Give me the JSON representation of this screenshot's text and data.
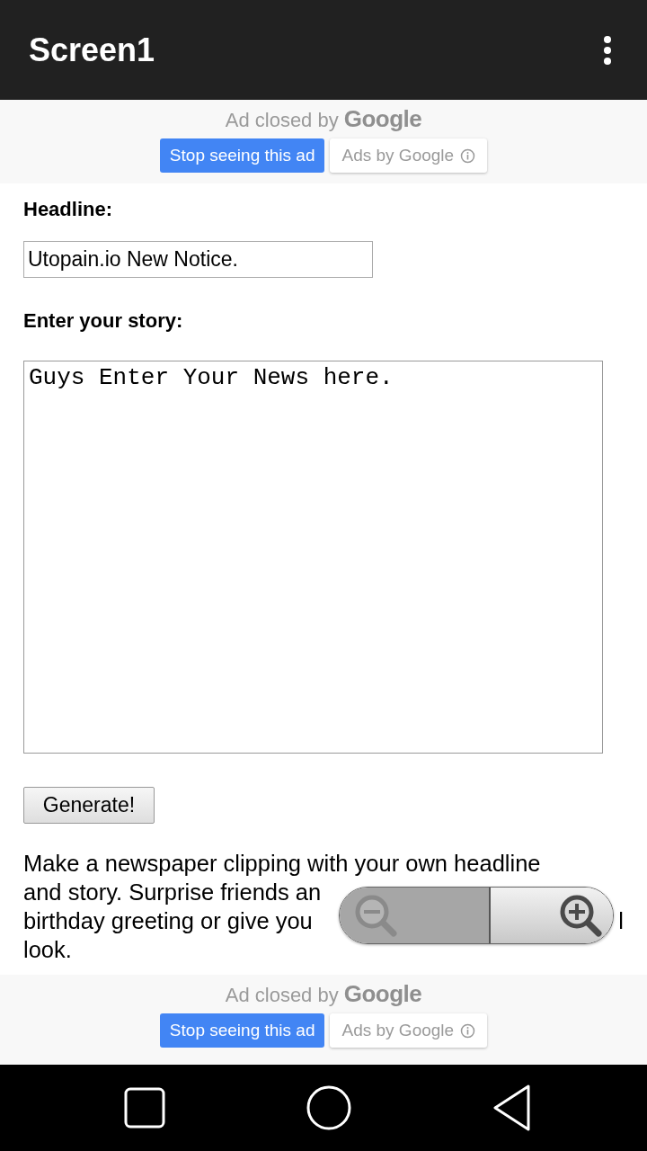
{
  "app_bar": {
    "title": "Screen1"
  },
  "ads": [
    {
      "closed_text": "Ad closed by",
      "brand": "Google",
      "stop_button": "Stop seeing this ad",
      "ads_by": "Ads by Google"
    },
    {
      "closed_text": "Ad closed by",
      "brand": "Google",
      "stop_button": "Stop seeing this ad",
      "ads_by": "Ads by Google"
    }
  ],
  "form": {
    "headline_label": "Headline:",
    "headline_value": "Utopain.io New Notice.",
    "story_label": "Enter your story:",
    "story_value": "Guys Enter Your News here.",
    "generate_button": "Generate!"
  },
  "description_lines": [
    [
      "Make a newspaper clipping with your own headline"
    ],
    [
      "and story. Surprise friends an"
    ],
    [
      "birthday greeting or give you",
      "l"
    ],
    [
      "look."
    ]
  ]
}
